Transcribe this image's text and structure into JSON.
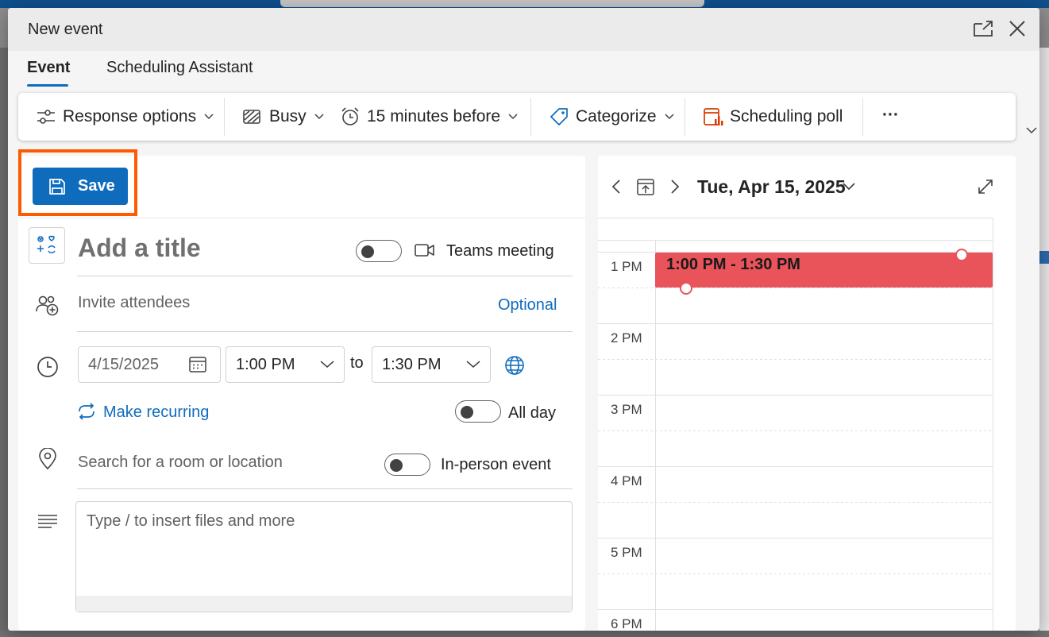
{
  "window": {
    "title": "New event"
  },
  "tabs": [
    {
      "label": "Event",
      "active": true
    },
    {
      "label": "Scheduling Assistant",
      "active": false
    }
  ],
  "toolbar": {
    "response_options": "Response options",
    "busy": "Busy",
    "reminder": "15 minutes before",
    "categorize": "Categorize",
    "scheduling_poll": "Scheduling poll",
    "more": "···"
  },
  "form": {
    "save_label": "Save",
    "title_placeholder": "Add a title",
    "teams_meeting_label": "Teams meeting",
    "teams_meeting_on": false,
    "attendees_placeholder": "Invite attendees",
    "optional_link": "Optional",
    "date": "4/15/2025",
    "start_time": "1:00 PM",
    "to_label": "to",
    "end_time": "1:30 PM",
    "make_recurring": "Make recurring",
    "all_day_label": "All day",
    "all_day_on": false,
    "location_placeholder": "Search for a room or location",
    "in_person_label": "In-person event",
    "in_person_on": false,
    "body_placeholder": "Type / to insert files and more"
  },
  "calendar": {
    "date_label": "Tue, Apr 15, 2025",
    "hours": [
      "1 PM",
      "2 PM",
      "3 PM",
      "4 PM",
      "5 PM",
      "6 PM"
    ],
    "event_time": "1:00 PM - 1:30 PM"
  },
  "colors": {
    "accent": "#0f6cbd",
    "highlight": "#ff5a00",
    "event": "#e9535a"
  },
  "icons": [
    "popout-icon",
    "close-icon",
    "sliders-icon",
    "busy-icon",
    "alarm-clock-icon",
    "tag-icon",
    "poll-icon",
    "more-icon",
    "save-icon",
    "title-emoji-icon",
    "video-icon",
    "people-add-icon",
    "clock-icon",
    "calendar-icon",
    "globe-icon",
    "repeat-icon",
    "location-icon",
    "text-align-icon",
    "chevron-left-icon",
    "today-icon",
    "chevron-right-icon",
    "expand-icon"
  ]
}
